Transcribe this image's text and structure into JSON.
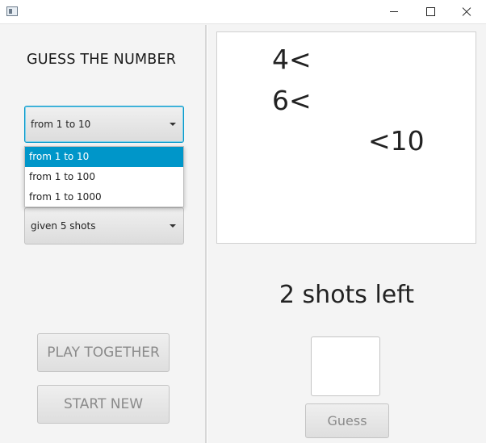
{
  "window": {
    "buttons": {
      "minimize": "minimize",
      "maximize": "maximize",
      "close": "close"
    }
  },
  "left": {
    "title": "GUESS THE NUMBER",
    "range_combo": {
      "value": "from 1 to 10",
      "options": [
        "from 1 to 10",
        "from 1 to 100",
        "from 1 to 1000"
      ],
      "selected_index": 0
    },
    "shots_combo": {
      "value": "given 5 shots"
    },
    "play_together_label": "PLAY TOGETHER",
    "start_new_label": "START NEW"
  },
  "right": {
    "history": [
      "4<",
      "6<",
      "<10"
    ],
    "shots_left": "2 shots left",
    "guess_input_value": "",
    "guess_label": "Guess"
  },
  "colors": {
    "accent": "#0096c9",
    "background": "#f4f4f4"
  }
}
